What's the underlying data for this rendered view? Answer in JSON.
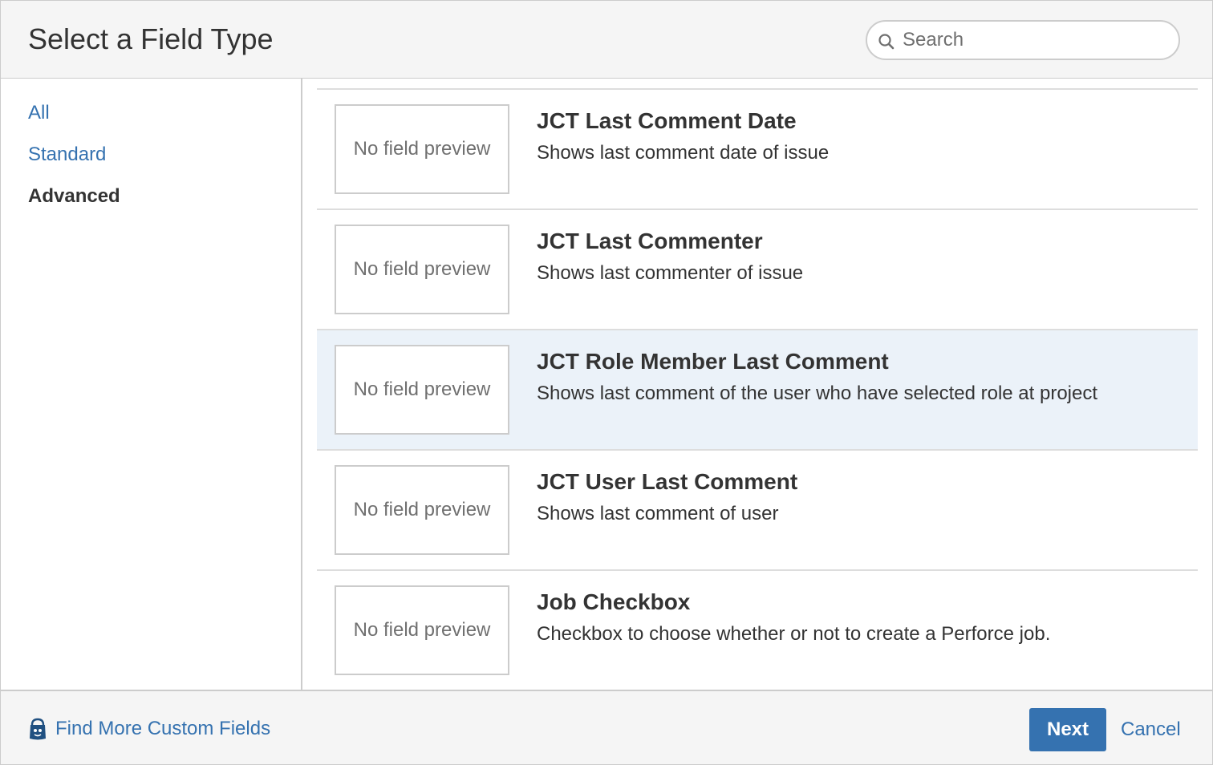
{
  "dialog": {
    "title": "Select a Field Type"
  },
  "search": {
    "placeholder": "Search",
    "value": "",
    "icon": "search-icon"
  },
  "sidebar": {
    "items": [
      {
        "label": "All",
        "selected": false
      },
      {
        "label": "Standard",
        "selected": false
      },
      {
        "label": "Advanced",
        "selected": true
      }
    ]
  },
  "field_types": [
    {
      "preview": "No field preview",
      "name": "JCT Last Comment Date",
      "description": "Shows last comment date of issue",
      "selected": false
    },
    {
      "preview": "No field preview",
      "name": "JCT Last Commenter",
      "description": "Shows last commenter of issue",
      "selected": false
    },
    {
      "preview": "No field preview",
      "name": "JCT Role Member Last Comment",
      "description": "Shows last comment of the user who have selected role at project",
      "selected": true
    },
    {
      "preview": "No field preview",
      "name": "JCT User Last Comment",
      "description": "Shows last comment of user",
      "selected": false
    },
    {
      "preview": "No field preview",
      "name": "Job Checkbox",
      "description": "Checkbox to choose whether or not to create a Perforce job.",
      "selected": false
    }
  ],
  "footer": {
    "find_more_label": "Find More Custom Fields",
    "find_more_icon": "marketplace-icon",
    "next_label": "Next",
    "cancel_label": "Cancel"
  },
  "colors": {
    "link": "#3572b0",
    "primary_button": "#3572b0",
    "selected_row": "#ebf2f9",
    "header_bg": "#f5f5f5"
  }
}
